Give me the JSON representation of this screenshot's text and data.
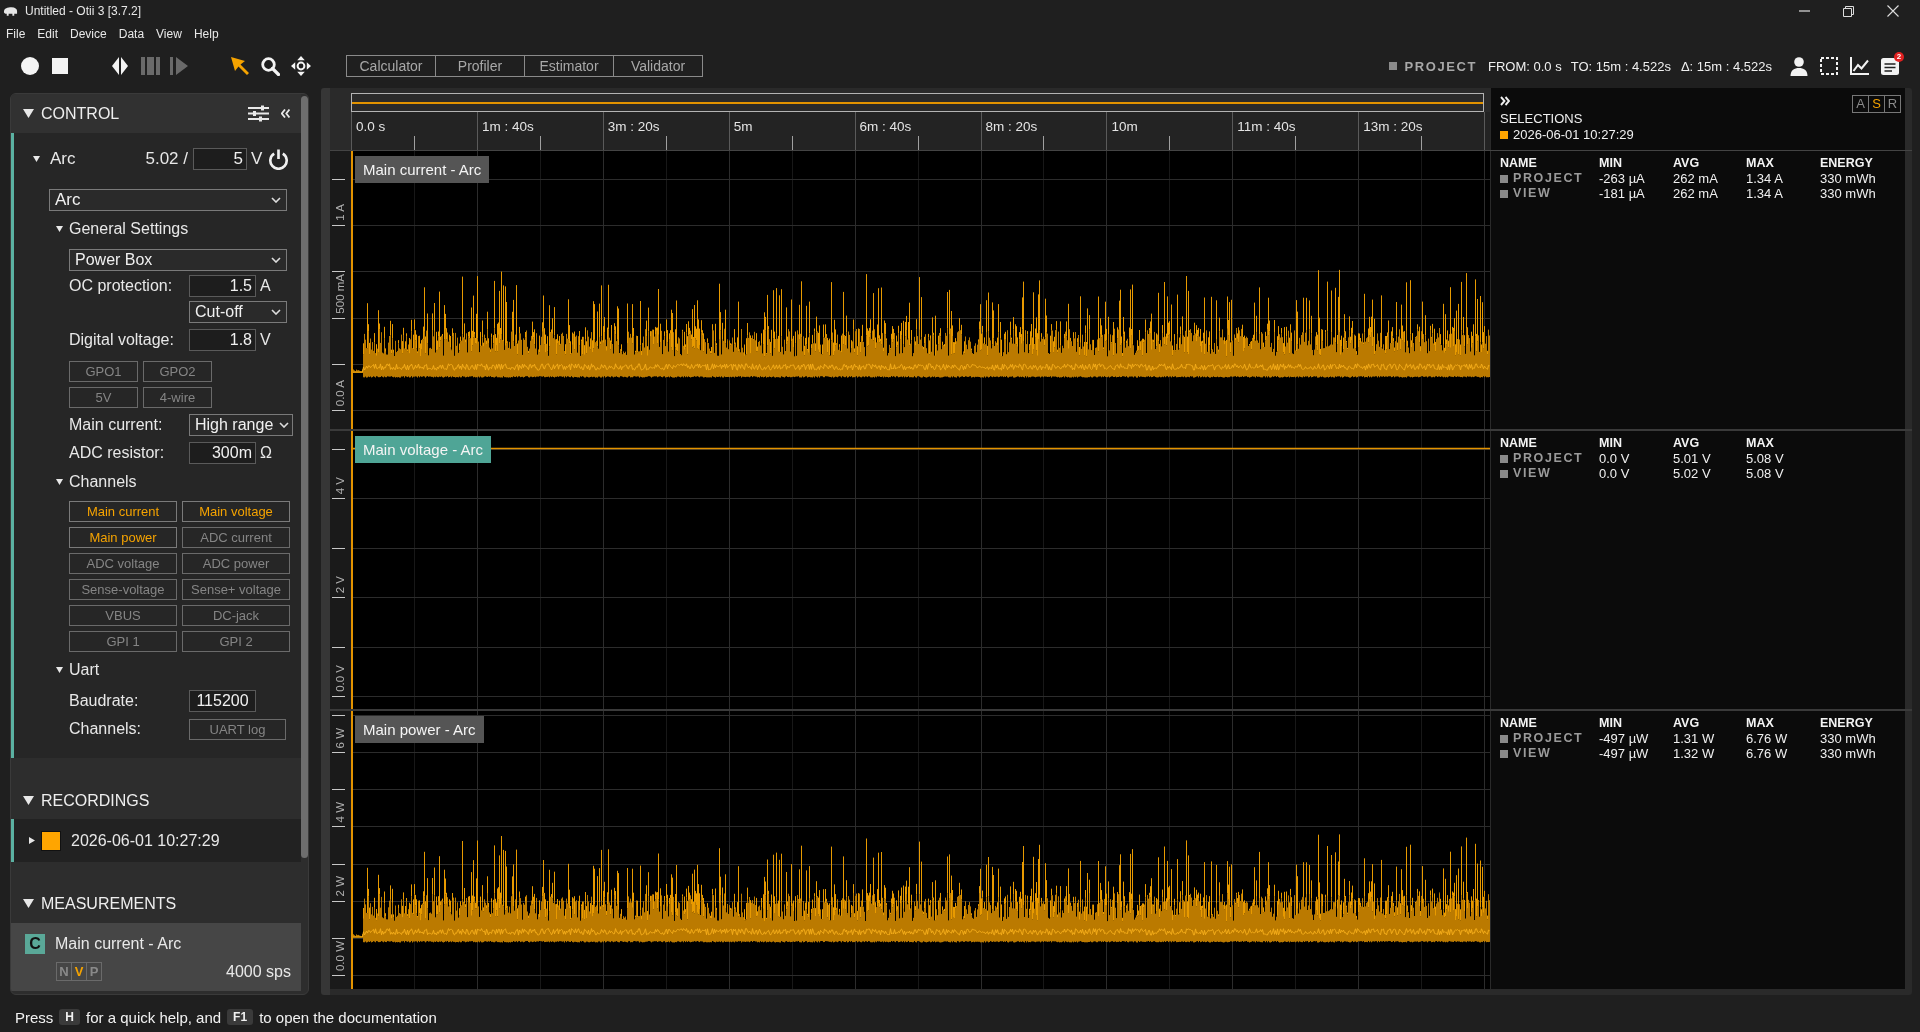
{
  "window": {
    "title": "Untitled - Otii 3 [3.7.2]"
  },
  "menu": [
    "File",
    "Edit",
    "Device",
    "Data",
    "View",
    "Help"
  ],
  "toolbar": {
    "controls": [
      {
        "kind": "record",
        "disabled": false
      },
      {
        "kind": "stop",
        "disabled": false
      },
      {
        "kind": "split",
        "disabled": false
      },
      {
        "kind": "trim",
        "disabled": true
      },
      {
        "kind": "forward",
        "disabled": true
      }
    ],
    "tools": [
      {
        "kind": "pointer",
        "selected": true
      },
      {
        "kind": "zoom",
        "selected": false
      },
      {
        "kind": "pan",
        "selected": false
      }
    ],
    "buttons": [
      "Calculator",
      "Profiler",
      "Estimator",
      "Validator"
    ],
    "range": {
      "scope": "PROJECT",
      "from": "FROM: 0.0 s",
      "to": "TO: 15m : 4.522s",
      "delta": "Δ: 15m : 4.522s"
    },
    "notification_badge": "2"
  },
  "control": {
    "title": "CONTROL",
    "expanded": true,
    "device": {
      "name": "Arc",
      "expanded": true,
      "reading": "5.02 /",
      "set_voltage": "5",
      "unit": "V",
      "model": "Arc",
      "general_settings": {
        "title": "General Settings",
        "expanded": true,
        "mode": "Power Box",
        "oc_protection": {
          "label": "OC protection:",
          "value": "1.5",
          "unit": "A"
        },
        "oc_action": "Cut-off",
        "digital_voltage": {
          "label": "Digital voltage:",
          "value": "1.8",
          "unit": "V"
        },
        "toggles": [
          {
            "label": "GPO1",
            "on": false
          },
          {
            "label": "GPO2",
            "on": false
          },
          {
            "label": "5V",
            "on": false
          },
          {
            "label": "4-wire",
            "on": false
          }
        ],
        "main_current": {
          "label": "Main current:",
          "value": "High range"
        },
        "adc_resistor": {
          "label": "ADC resistor:",
          "value": "300m",
          "unit": "Ω"
        }
      },
      "channels": {
        "title": "Channels",
        "expanded": true,
        "items": [
          {
            "label": "Main current",
            "on": true
          },
          {
            "label": "Main voltage",
            "on": true
          },
          {
            "label": "Main power",
            "on": true
          },
          {
            "label": "ADC current",
            "on": false
          },
          {
            "label": "ADC voltage",
            "on": false
          },
          {
            "label": "ADC power",
            "on": false
          },
          {
            "label": "Sense-voltage",
            "on": false
          },
          {
            "label": "Sense+ voltage",
            "on": false
          },
          {
            "label": "VBUS",
            "on": false
          },
          {
            "label": "DC-jack",
            "on": false
          },
          {
            "label": "GPI 1",
            "on": false
          },
          {
            "label": "GPI 2",
            "on": false
          }
        ]
      },
      "uart": {
        "title": "Uart",
        "expanded": true,
        "baudrate": {
          "label": "Baudrate:",
          "value": "115200"
        },
        "channels": {
          "label": "Channels:",
          "items": [
            {
              "label": "UART log",
              "on": false
            }
          ]
        }
      }
    }
  },
  "recordings": {
    "title": "RECORDINGS",
    "expanded": true,
    "items": [
      {
        "label": "2026-06-01 10:27:29",
        "color": "#ffa500",
        "expanded": false
      }
    ]
  },
  "measurements": {
    "title": "MEASUREMENTS",
    "expanded": true,
    "items": [
      {
        "type": "C",
        "label": "Main current - Arc",
        "modes": [
          {
            "label": "N",
            "selected": false
          },
          {
            "label": "V",
            "selected": true
          },
          {
            "label": "P",
            "selected": false
          }
        ],
        "rate": "4000 sps"
      }
    ]
  },
  "timeline": {
    "labels": [
      "0.0 s",
      "1m : 40s",
      "3m : 20s",
      "5m",
      "6m : 40s",
      "8m : 20s",
      "10m",
      "11m : 40s",
      "13m : 20s"
    ]
  },
  "selections": {
    "title": "SELECTIONS",
    "view_modes": [
      {
        "label": "A",
        "selected": false
      },
      {
        "label": "S",
        "selected": true
      },
      {
        "label": "R",
        "selected": false
      }
    ],
    "items": [
      {
        "label": "2026-06-01 10:27:29",
        "color": "#ffa500"
      }
    ]
  },
  "charts": [
    {
      "kind": "current",
      "label": "Main current - Arc",
      "selected": false,
      "y_labels": [
        "1 A",
        "500 mA",
        "0.0 A"
      ],
      "stats": {
        "columns": [
          "NAME",
          "MIN",
          "AVG",
          "MAX",
          "ENERGY"
        ],
        "rows": [
          {
            "name": "PROJECT",
            "values": [
              "-263 µA",
              "262 mA",
              "1.34 A",
              "330 mWh"
            ]
          },
          {
            "name": "VIEW",
            "values": [
              "-181 µA",
              "262 mA",
              "1.34 A",
              "330 mWh"
            ]
          }
        ]
      }
    },
    {
      "kind": "voltage",
      "label": "Main voltage - Arc",
      "selected": true,
      "y_labels": [
        "4 V",
        "2 V",
        "0.0 V"
      ],
      "stats": {
        "columns": [
          "NAME",
          "MIN",
          "AVG",
          "MAX"
        ],
        "rows": [
          {
            "name": "PROJECT",
            "values": [
              "0.0 V",
              "5.01 V",
              "5.08 V"
            ]
          },
          {
            "name": "VIEW",
            "values": [
              "0.0 V",
              "5.02 V",
              "5.08 V"
            ]
          }
        ]
      }
    },
    {
      "kind": "power",
      "label": "Main power - Arc",
      "selected": false,
      "y_labels": [
        "6 W",
        "4 W",
        "2 W",
        "0.0 W"
      ],
      "stats": {
        "columns": [
          "NAME",
          "MIN",
          "AVG",
          "MAX",
          "ENERGY"
        ],
        "rows": [
          {
            "name": "PROJECT",
            "values": [
              "-497 µW",
              "1.31 W",
              "6.76 W",
              "330 mWh"
            ]
          },
          {
            "name": "VIEW",
            "values": [
              "-497 µW",
              "1.32 W",
              "6.76 W",
              "330 mWh"
            ]
          }
        ]
      }
    }
  ],
  "status_bar": [
    {
      "kind": "text",
      "text": "Press"
    },
    {
      "kind": "key",
      "text": "H"
    },
    {
      "kind": "text",
      "text": "for a quick help, and"
    },
    {
      "kind": "key",
      "text": "F1"
    },
    {
      "kind": "text",
      "text": "to open the documentation"
    }
  ]
}
